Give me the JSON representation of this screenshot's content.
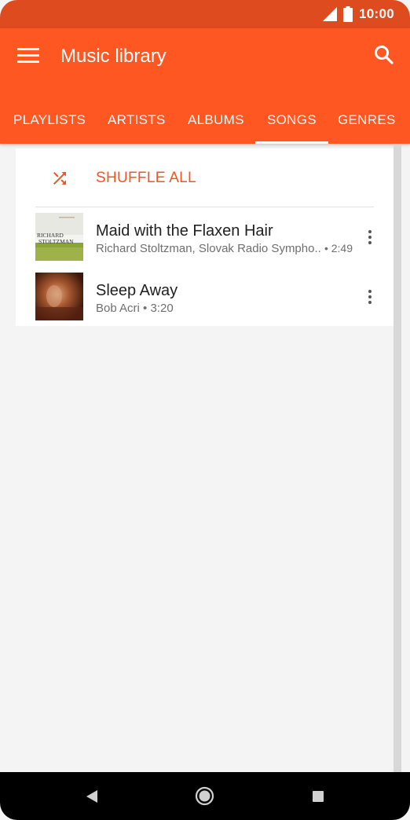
{
  "status": {
    "time": "10:00"
  },
  "app_bar": {
    "title": "Music library"
  },
  "tabs": [
    {
      "label": "PLAYLISTS"
    },
    {
      "label": "ARTISTS"
    },
    {
      "label": "ALBUMS"
    },
    {
      "label": "SONGS"
    },
    {
      "label": "GENRES"
    }
  ],
  "active_tab": "SONGS",
  "shuffle": {
    "label": "SHUFFLE ALL"
  },
  "songs": [
    {
      "title": "Maid with the Flaxen Hair",
      "artist": "Richard Stoltzman, Slovak Radio Sympho..",
      "duration": "• 2:49",
      "art_text_1": "RICHARD",
      "art_text_2": "STOLTZMAN"
    },
    {
      "title": "Sleep Away",
      "artist": "Bob Acri",
      "duration": "• 3:20"
    }
  ],
  "colors": {
    "accent": "#ff5722",
    "status_bar": "#dd4b1f",
    "shuffle_text": "#f05522"
  },
  "icons": {
    "menu": "menu-icon",
    "search": "search-icon",
    "shuffle": "shuffle-icon",
    "more": "more-vert-icon",
    "back": "back-icon",
    "home": "home-icon",
    "recents": "recents-icon",
    "signal": "signal-icon",
    "battery": "battery-icon"
  }
}
